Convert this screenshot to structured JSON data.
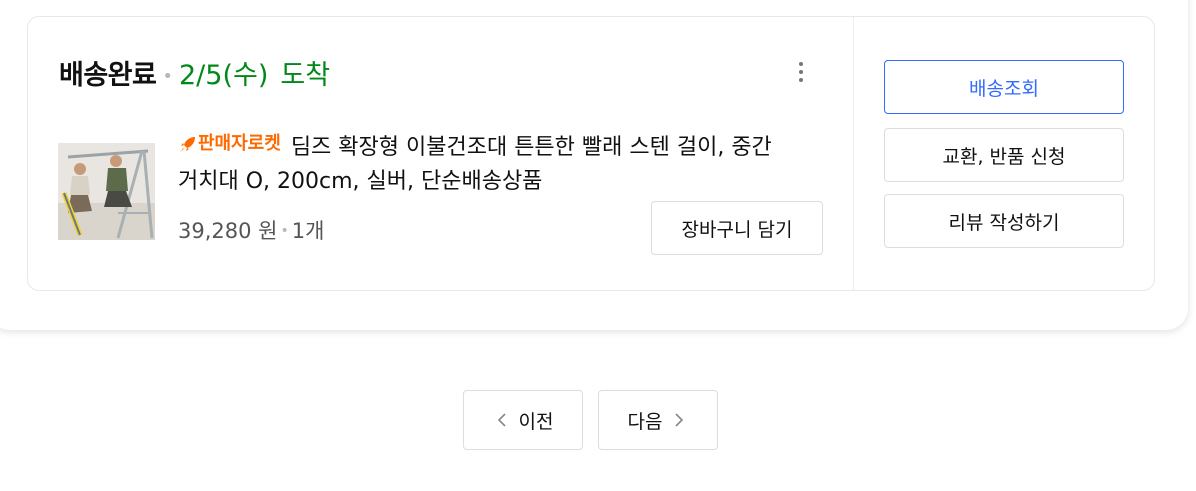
{
  "order": {
    "status": "배송완료",
    "delivery_date": "2/5(수)",
    "arrival_text": "도착",
    "more_icon": "more-vertical-icon"
  },
  "product": {
    "seller_badge": "판매자로켓",
    "badge_icon": "rocket-icon",
    "name": "딤즈 확장형 이불건조대 튼튼한 빨래 스텐 걸이, 중간 거치대 O, 200cm, 실버, 단순배송상품",
    "price": "39,280 원",
    "quantity": "1개",
    "cart_button": "장바구니 담기"
  },
  "actions": {
    "track": "배송조회",
    "exchange_return": "교환, 반품 신청",
    "write_review": "리뷰 작성하기"
  },
  "pagination": {
    "prev": "이전",
    "next": "다음"
  },
  "colors": {
    "status_green": "#00891a",
    "badge_orange": "#ff6a00",
    "primary_blue": "#346aff"
  }
}
